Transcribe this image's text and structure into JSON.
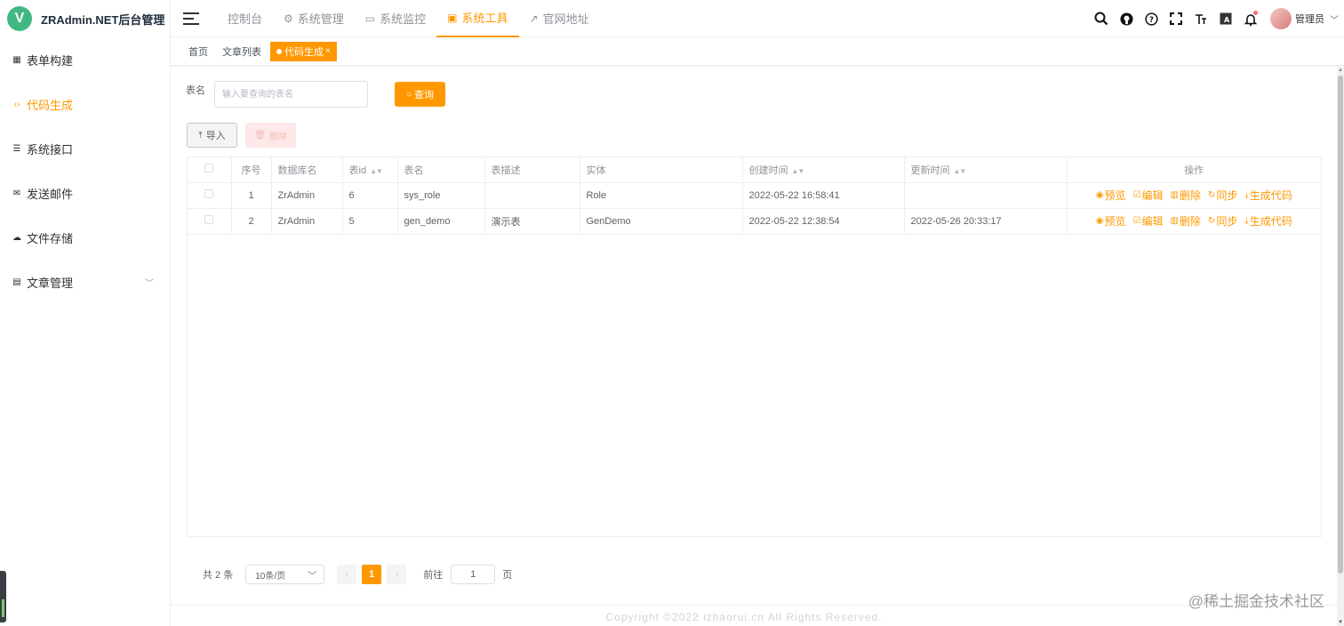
{
  "brand": {
    "logo_letter": "V",
    "title": "ZRAdmin.NET后台管理"
  },
  "sidebar": {
    "items": [
      {
        "label": "表单构建",
        "icon": "table-icon",
        "glyph": "▦",
        "active": false
      },
      {
        "label": "代码生成",
        "icon": "code-icon",
        "glyph": "‹›",
        "active": true
      },
      {
        "label": "系统接口",
        "icon": "sliders-icon",
        "glyph": "☰",
        "active": false
      },
      {
        "label": "发送邮件",
        "icon": "mail-icon",
        "glyph": "✉",
        "active": false
      },
      {
        "label": "文件存储",
        "icon": "cloud-upload-icon",
        "glyph": "☁",
        "active": false
      },
      {
        "label": "文章管理",
        "icon": "document-icon",
        "glyph": "▤",
        "active": false,
        "has_children": true
      }
    ]
  },
  "topnav": {
    "items": [
      {
        "label": "控制台",
        "glyph": "",
        "active": false
      },
      {
        "label": "系统管理",
        "glyph": "⚙",
        "active": false
      },
      {
        "label": "系统监控",
        "glyph": "▭",
        "active": false
      },
      {
        "label": "系统工具",
        "glyph": "▣",
        "active": true
      },
      {
        "label": "官网地址",
        "glyph": "↗",
        "active": false
      }
    ]
  },
  "header_icons": [
    "search-icon",
    "github-icon",
    "help-icon",
    "fullscreen-icon",
    "font-size-icon",
    "translate-icon",
    "bell-icon"
  ],
  "user": {
    "name": "管理员"
  },
  "tags": [
    {
      "label": "首页",
      "active": false
    },
    {
      "label": "文章列表",
      "active": false
    },
    {
      "label": "代码生成",
      "active": true,
      "close": "×"
    }
  ],
  "search": {
    "label": "表名",
    "placeholder": "输入要查询的表名",
    "query_label": "查询"
  },
  "toolbar": {
    "import_label": "导入",
    "delete_label": "删除"
  },
  "table": {
    "columns": [
      "序号",
      "数据库名",
      "表id",
      "表名",
      "表描述",
      "实体",
      "创建时间",
      "更新时间",
      "操作"
    ],
    "rows": [
      {
        "index": "1",
        "db": "ZrAdmin",
        "id": "6",
        "name": "sys_role",
        "desc": "",
        "entity": "Role",
        "created": "2022-05-22 16:58:41",
        "updated": ""
      },
      {
        "index": "2",
        "db": "ZrAdmin",
        "id": "5",
        "name": "gen_demo",
        "desc": "演示表",
        "entity": "GenDemo",
        "created": "2022-05-22 12:38:54",
        "updated": "2022-05-26 20:33:17"
      }
    ],
    "actions": [
      "预览",
      "编辑",
      "删除",
      "同步",
      "生成代码"
    ]
  },
  "pagination": {
    "total": "共 2 条",
    "page_size": "10条/页",
    "current": "1",
    "goto_label": "前往",
    "goto_value": "1",
    "page_suffix": "页"
  },
  "footer": {
    "copyright": "Copyright ©2022 izhaorui.cn All Rights Reserved."
  },
  "watermark": "@稀土掘金技术社区",
  "colors": {
    "accent": "#ff9800",
    "brand_logo": "#41b883",
    "danger_light": "#fde9e9"
  }
}
